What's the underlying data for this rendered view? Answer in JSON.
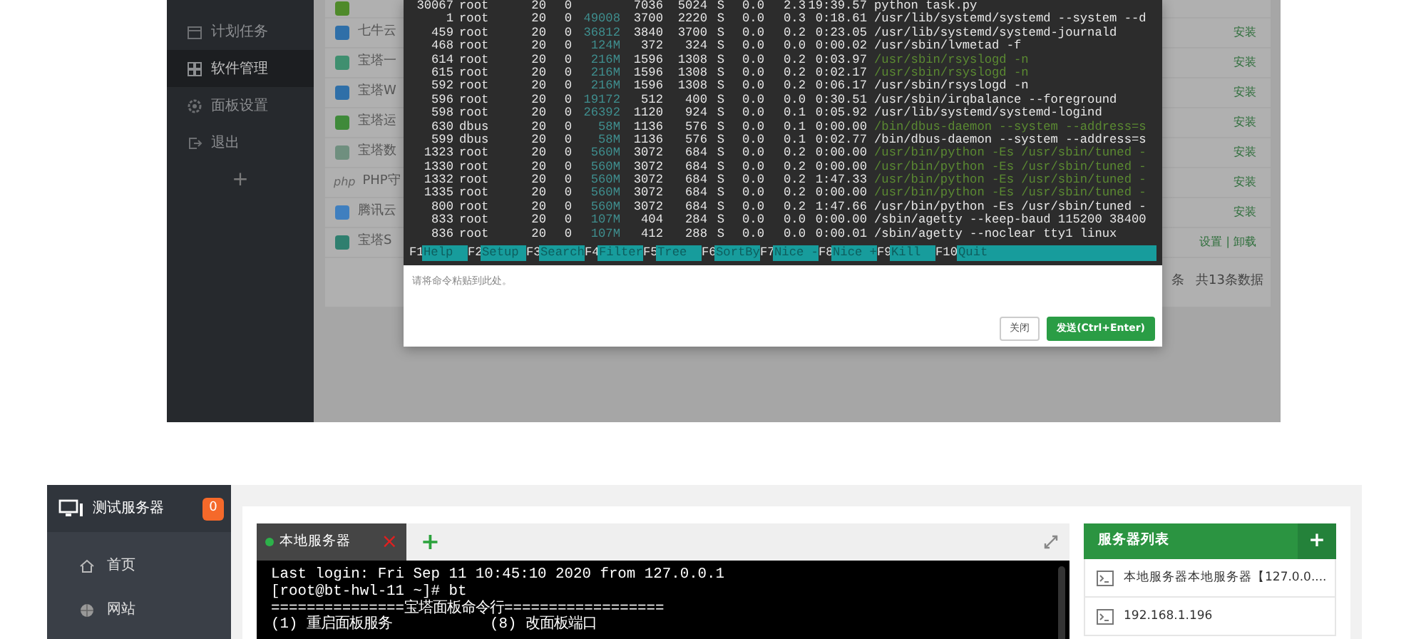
{
  "top_screenshot": {
    "sidebar": {
      "items": [
        {
          "label": "计划任务",
          "selected": false
        },
        {
          "label": "软件管理",
          "selected": true
        },
        {
          "label": "面板设置",
          "selected": false
        },
        {
          "label": "退出",
          "selected": false
        }
      ],
      "add_label": "+"
    },
    "apps": [
      {
        "kind": "partial"
      },
      {
        "kind": "app",
        "name": "七牛云",
        "action": "安装"
      },
      {
        "kind": "app",
        "name": "宝塔一",
        "action": "安装"
      },
      {
        "kind": "app",
        "name": "宝塔W",
        "action": "安装"
      },
      {
        "kind": "app",
        "name": "宝塔运",
        "action": "安装"
      },
      {
        "kind": "app",
        "name": "宝塔数",
        "action": "安装"
      },
      {
        "kind": "app",
        "logo": "php",
        "name": "PHP守",
        "action": "安装"
      },
      {
        "kind": "app",
        "name": "腾讯云",
        "action": "安装"
      },
      {
        "kind": "app",
        "name": "宝塔S",
        "action": "设置 | 卸载"
      }
    ],
    "footer": {
      "page_fragment": "条",
      "total": "共13条数据"
    },
    "terminal": {
      "rows": [
        {
          "pid": "30067",
          "user": "root",
          "pri": "20",
          "ni": "0",
          "virt": "",
          "res": "7036",
          "shr": "5024",
          "s": "S",
          "cpu": "0.0",
          "mem": "2.3",
          "time": "19:39.57",
          "command": "python task.py",
          "thread": false
        },
        {
          "pid": "1",
          "user": "root",
          "pri": "20",
          "ni": "0",
          "virt": "49008",
          "res": "3700",
          "shr": "2220",
          "s": "S",
          "cpu": "0.0",
          "mem": "0.3",
          "time": "0:18.61",
          "command": "/usr/lib/systemd/systemd --system --d",
          "thread": false
        },
        {
          "pid": "459",
          "user": "root",
          "pri": "20",
          "ni": "0",
          "virt": "36812",
          "res": "3840",
          "shr": "3700",
          "s": "S",
          "cpu": "0.0",
          "mem": "0.2",
          "time": "0:23.05",
          "command": "/usr/lib/systemd/systemd-journald",
          "thread": false
        },
        {
          "pid": "468",
          "user": "root",
          "pri": "20",
          "ni": "0",
          "virt": "124M",
          "res": "372",
          "shr": "324",
          "s": "S",
          "cpu": "0.0",
          "mem": "0.0",
          "time": "0:00.02",
          "command": "/usr/sbin/lvmetad -f",
          "thread": false
        },
        {
          "pid": "614",
          "user": "root",
          "pri": "20",
          "ni": "0",
          "virt": "216M",
          "res": "1596",
          "shr": "1308",
          "s": "S",
          "cpu": "0.0",
          "mem": "0.2",
          "time": "0:03.97",
          "command": "/usr/sbin/rsyslogd -n",
          "thread": true
        },
        {
          "pid": "615",
          "user": "root",
          "pri": "20",
          "ni": "0",
          "virt": "216M",
          "res": "1596",
          "shr": "1308",
          "s": "S",
          "cpu": "0.0",
          "mem": "0.2",
          "time": "0:02.17",
          "command": "/usr/sbin/rsyslogd -n",
          "thread": true
        },
        {
          "pid": "592",
          "user": "root",
          "pri": "20",
          "ni": "0",
          "virt": "216M",
          "res": "1596",
          "shr": "1308",
          "s": "S",
          "cpu": "0.0",
          "mem": "0.2",
          "time": "0:06.17",
          "command": "/usr/sbin/rsyslogd -n",
          "thread": false
        },
        {
          "pid": "596",
          "user": "root",
          "pri": "20",
          "ni": "0",
          "virt": "19172",
          "res": "512",
          "shr": "400",
          "s": "S",
          "cpu": "0.0",
          "mem": "0.0",
          "time": "0:30.51",
          "command": "/usr/sbin/irqbalance --foreground",
          "thread": false
        },
        {
          "pid": "598",
          "user": "root",
          "pri": "20",
          "ni": "0",
          "virt": "26392",
          "res": "1120",
          "shr": "924",
          "s": "S",
          "cpu": "0.0",
          "mem": "0.1",
          "time": "0:05.92",
          "command": "/usr/lib/systemd/systemd-logind",
          "thread": false
        },
        {
          "pid": "630",
          "user": "dbus",
          "pri": "20",
          "ni": "0",
          "virt": "58M",
          "res": "1136",
          "shr": "576",
          "s": "S",
          "cpu": "0.0",
          "mem": "0.1",
          "time": "0:00.00",
          "command": "/bin/dbus-daemon --system --address=s",
          "thread": true
        },
        {
          "pid": "599",
          "user": "dbus",
          "pri": "20",
          "ni": "0",
          "virt": "58M",
          "res": "1136",
          "shr": "576",
          "s": "S",
          "cpu": "0.0",
          "mem": "0.1",
          "time": "0:02.77",
          "command": "/bin/dbus-daemon --system --address=s",
          "thread": false
        },
        {
          "pid": "1323",
          "user": "root",
          "pri": "20",
          "ni": "0",
          "virt": "560M",
          "res": "3072",
          "shr": "684",
          "s": "S",
          "cpu": "0.0",
          "mem": "0.2",
          "time": "0:00.00",
          "command": "/usr/bin/python -Es /usr/sbin/tuned -",
          "thread": true
        },
        {
          "pid": "1330",
          "user": "root",
          "pri": "20",
          "ni": "0",
          "virt": "560M",
          "res": "3072",
          "shr": "684",
          "s": "S",
          "cpu": "0.0",
          "mem": "0.2",
          "time": "0:00.00",
          "command": "/usr/bin/python -Es /usr/sbin/tuned -",
          "thread": true
        },
        {
          "pid": "1332",
          "user": "root",
          "pri": "20",
          "ni": "0",
          "virt": "560M",
          "res": "3072",
          "shr": "684",
          "s": "S",
          "cpu": "0.0",
          "mem": "0.2",
          "time": "1:47.33",
          "command": "/usr/bin/python -Es /usr/sbin/tuned -",
          "thread": true
        },
        {
          "pid": "1335",
          "user": "root",
          "pri": "20",
          "ni": "0",
          "virt": "560M",
          "res": "3072",
          "shr": "684",
          "s": "S",
          "cpu": "0.0",
          "mem": "0.2",
          "time": "0:00.00",
          "command": "/usr/bin/python -Es /usr/sbin/tuned -",
          "thread": true
        },
        {
          "pid": "800",
          "user": "root",
          "pri": "20",
          "ni": "0",
          "virt": "560M",
          "res": "3072",
          "shr": "684",
          "s": "S",
          "cpu": "0.0",
          "mem": "0.2",
          "time": "1:47.66",
          "command": "/usr/bin/python -Es /usr/sbin/tuned -",
          "thread": false
        },
        {
          "pid": "833",
          "user": "root",
          "pri": "20",
          "ni": "0",
          "virt": "107M",
          "res": "404",
          "shr": "284",
          "s": "S",
          "cpu": "0.0",
          "mem": "0.0",
          "time": "0:00.00",
          "command": "/sbin/agetty --keep-baud 115200 38400",
          "thread": false
        },
        {
          "pid": "836",
          "user": "root",
          "pri": "20",
          "ni": "0",
          "virt": "107M",
          "res": "412",
          "shr": "288",
          "s": "S",
          "cpu": "0.0",
          "mem": "0.0",
          "time": "0:00.01",
          "command": "/sbin/agetty --noclear tty1 linux",
          "thread": false
        }
      ],
      "function_keys": [
        {
          "key": "F1",
          "label": "Help"
        },
        {
          "key": "F2",
          "label": "Setup"
        },
        {
          "key": "F3",
          "label": "Search"
        },
        {
          "key": "F4",
          "label": "Filter"
        },
        {
          "key": "F5",
          "label": "Tree"
        },
        {
          "key": "F6",
          "label": "SortBy"
        },
        {
          "key": "F7",
          "label": "Nice -"
        },
        {
          "key": "F8",
          "label": "Nice +"
        },
        {
          "key": "F9",
          "label": "Kill"
        },
        {
          "key": "F10",
          "label": "Quit"
        }
      ]
    },
    "command_input": {
      "placeholder": "请将命令粘贴到此处。"
    },
    "buttons": [
      {
        "label": "关闭",
        "kind": "default"
      },
      {
        "label": "发送(Ctrl+Enter)",
        "kind": "primary"
      }
    ]
  },
  "bottom_screenshot": {
    "server_name": "测试服务器",
    "badge": "0",
    "sidebar": {
      "items": [
        {
          "label": "首页"
        },
        {
          "label": "网站"
        }
      ]
    },
    "tabs": [
      {
        "label": "本地服务器",
        "online": true,
        "selected": true,
        "close": "×"
      }
    ],
    "add_tab": "+",
    "terminal_lines": [
      "Last login: Fri Sep 11 10:45:10 2020 from 127.0.0.1",
      "[root@bt-hwl-11 ~]# bt",
      "===============宝塔面板命令行==================",
      "(1) 重启面板服务           (8) 改面板端口"
    ],
    "server_list": {
      "title": "服务器列表",
      "add": "+",
      "items": [
        "本地服务器本地服务器【127.0.0....",
        "192.168.1.196"
      ]
    }
  }
}
